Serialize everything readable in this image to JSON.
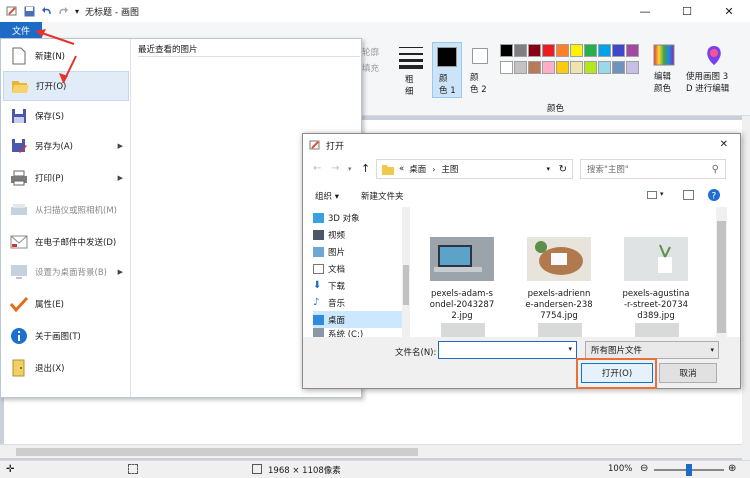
{
  "window": {
    "title": "无标题 - 画图",
    "minimize": "—",
    "maximize": "☐",
    "close": "✕"
  },
  "ribbon": {
    "file_tab": "文件",
    "outline": "轮廓",
    "fill": "填充",
    "size": "粗\n细",
    "color1": "颜\n色 1",
    "color2": "颜\n色 2",
    "colors_group": "颜色",
    "edit_colors": "编辑\n颜色",
    "paint3d": "使用画图 3\nD 进行编辑"
  },
  "palette": [
    "#000000",
    "#7f7f7f",
    "#880015",
    "#ed1c24",
    "#ff7f27",
    "#fff200",
    "#22b14c",
    "#00a2e8",
    "#3f48cc",
    "#a349a4",
    "#ffffff",
    "#c3c3c3",
    "#b97a57",
    "#ffaec9",
    "#ffc90e",
    "#efe4b0",
    "#b5e61d",
    "#99d9ea",
    "#7092be",
    "#c8bfe7"
  ],
  "file_menu": {
    "recent_title": "最近查看的图片",
    "items": [
      {
        "label": "新建(N)",
        "icon": "new-file-icon",
        "enabled": true,
        "arrow": false
      },
      {
        "label": "打开(O)",
        "icon": "open-folder-icon",
        "enabled": true,
        "arrow": false
      },
      {
        "label": "保存(S)",
        "icon": "save-icon",
        "enabled": true,
        "arrow": false
      },
      {
        "label": "另存为(A)",
        "icon": "save-as-icon",
        "enabled": true,
        "arrow": true
      },
      {
        "label": "打印(P)",
        "icon": "printer-icon",
        "enabled": true,
        "arrow": true
      },
      {
        "label": "从扫描仪或照相机(M)",
        "icon": "scanner-icon",
        "enabled": false,
        "arrow": false
      },
      {
        "label": "在电子邮件中发送(D)",
        "icon": "email-icon",
        "enabled": true,
        "arrow": false
      },
      {
        "label": "设置为桌面背景(B)",
        "icon": "desktop-icon",
        "enabled": false,
        "arrow": true
      },
      {
        "label": "属性(E)",
        "icon": "checkmark-icon",
        "enabled": true,
        "arrow": false
      },
      {
        "label": "关于画图(T)",
        "icon": "info-icon",
        "enabled": true,
        "arrow": false
      },
      {
        "label": "退出(X)",
        "icon": "exit-icon",
        "enabled": true,
        "arrow": false
      }
    ]
  },
  "dialog": {
    "title": "打开",
    "close": "✕",
    "path_sep": "«",
    "path": [
      "桌面",
      "主图"
    ],
    "search_placeholder": "搜索\"主图\"",
    "organize": "组织 ▾",
    "new_folder": "新建文件夹",
    "nav": [
      "3D 对象",
      "视频",
      "图片",
      "文档",
      "下载",
      "音乐",
      "桌面",
      "系统 (C:)"
    ],
    "files": [
      {
        "name": "pexels-adam-s\nondel-2043287\n2.jpg"
      },
      {
        "name": "pexels-adrienn\ne-andersen-238\n7754.jpg"
      },
      {
        "name": "pexels-agustina\n-r-street-20734\nd389.jpg"
      }
    ],
    "filename_label": "文件名(N):",
    "filename_value": "",
    "filetype": "所有图片文件",
    "open_button": "打开(O)",
    "cancel_button": "取消"
  },
  "status": {
    "dimensions": "1968 × 1108像素",
    "zoom": "100%",
    "zoom_level": 0.5,
    "zoom_minus": "⊖",
    "zoom_plus": "⊕"
  }
}
